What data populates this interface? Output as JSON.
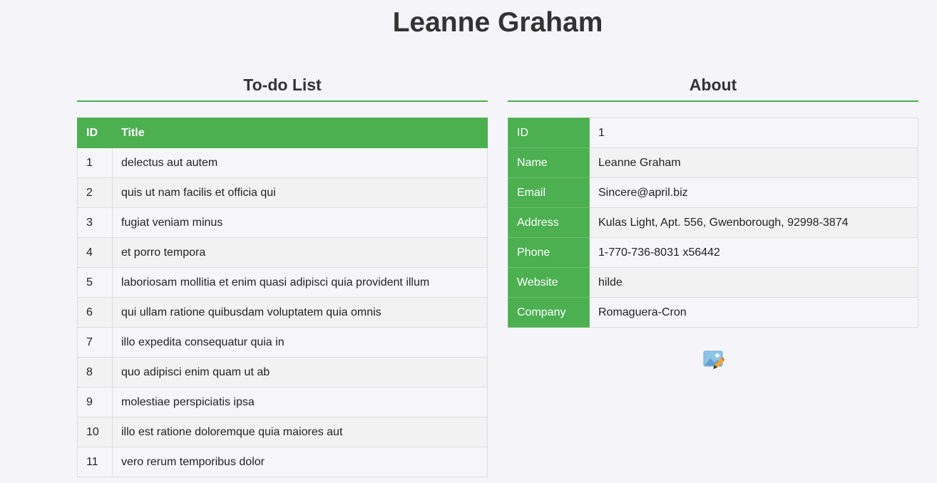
{
  "header": {
    "title": "Leanne Graham"
  },
  "todo": {
    "heading": "To-do List",
    "columns": [
      "ID",
      "Title"
    ],
    "rows": [
      {
        "id": "1",
        "title": "delectus aut autem"
      },
      {
        "id": "2",
        "title": "quis ut nam facilis et officia qui"
      },
      {
        "id": "3",
        "title": "fugiat veniam minus"
      },
      {
        "id": "4",
        "title": "et porro tempora"
      },
      {
        "id": "5",
        "title": "laboriosam mollitia et enim quasi adipisci quia provident illum"
      },
      {
        "id": "6",
        "title": "qui ullam ratione quibusdam voluptatem quia omnis"
      },
      {
        "id": "7",
        "title": "illo expedita consequatur quia in"
      },
      {
        "id": "8",
        "title": "quo adipisci enim quam ut ab"
      },
      {
        "id": "9",
        "title": "molestiae perspiciatis ipsa"
      },
      {
        "id": "10",
        "title": "illo est ratione doloremque quia maiores aut"
      },
      {
        "id": "11",
        "title": "vero rerum temporibus dolor"
      }
    ]
  },
  "about": {
    "heading": "About",
    "rows": [
      {
        "label": "ID",
        "value": "1"
      },
      {
        "label": "Name",
        "value": "Leanne Graham"
      },
      {
        "label": "Email",
        "value": "Sincere@april.biz"
      },
      {
        "label": "Address",
        "value": "Kulas Light, Apt. 556, Gwenborough, 92998-3874"
      },
      {
        "label": "Phone",
        "value": "1-770-736-8031 x56442"
      },
      {
        "label": "Website",
        "value": "hilde"
      },
      {
        "label": "Company",
        "value": "Romaguera-Cron"
      }
    ],
    "edit_icon": "edit-image-icon"
  },
  "colors": {
    "accent": "#4caf50",
    "background": "#f4f4f9",
    "text": "#333333"
  }
}
